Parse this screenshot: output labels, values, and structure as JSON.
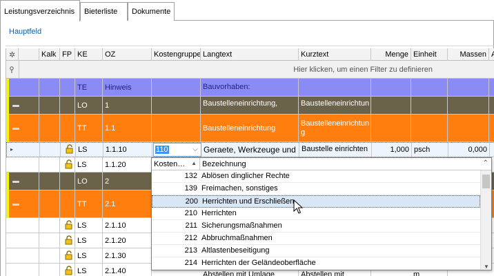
{
  "tabs": [
    "Leistungsverzeichnis",
    "Bieterliste",
    "Dokumente"
  ],
  "hauptfeld": "Hauptfeld",
  "columns": {
    "star": "✲",
    "kalk": "Kalk",
    "fp": "FP",
    "ke": "KE",
    "oz": "OZ",
    "kostengruppe": "Kostengruppe",
    "langtext": "Langtext",
    "kurztext": "Kurztext",
    "menge": "Menge",
    "einheit": "Einheit",
    "massen": "Massen",
    "extra": "A"
  },
  "filter_hint": "Hier klicken, um einen Filter zu definieren",
  "rows": [
    {
      "ke": "TE",
      "oz": "Hinweis",
      "lang": "Bauvorhaben:",
      "kurz": ""
    },
    {
      "ke": "LO",
      "oz": "1",
      "lang": "Baustelleneinrichtung,",
      "kurz": "Baustelleneinrichtun"
    },
    {
      "ke": "TT",
      "oz": "1.1",
      "lang": "Baustelleneinrichtung",
      "kurz": "Baustelleneinrichtun",
      "kurz2": "g"
    },
    {
      "ke": "LS",
      "oz": "1.1.10",
      "kg": "110",
      "lang": "Geraete, Werkzeuge und",
      "kurz": "Baustelle einrichten",
      "menge": "1,000",
      "einheit": "psch",
      "massen": "0,000"
    },
    {
      "ke": "LS",
      "oz": "1.1.20"
    },
    {
      "ke": "LO",
      "oz": "2"
    },
    {
      "ke": "TT",
      "oz": "2.1"
    },
    {
      "ke": "LS",
      "oz": "2.1.10"
    },
    {
      "ke": "LS",
      "oz": "2.1.20"
    },
    {
      "ke": "LS",
      "oz": "2.1.30"
    },
    {
      "ke": "LS",
      "oz": "2.1.40",
      "lang": "Abstellen mit Umlage",
      "kurz": "Abstellen mit",
      "einheit": "m"
    }
  ],
  "popup": {
    "col_code": "Kosten…",
    "col_name": "Bezeichnung",
    "items": [
      {
        "code": "132",
        "name": "Ablösen dinglicher Rechte"
      },
      {
        "code": "139",
        "name": "Freimachen, sonstiges"
      },
      {
        "code": "200",
        "name": "Herrichten und Erschließen"
      },
      {
        "code": "210",
        "name": "Herrichten"
      },
      {
        "code": "211",
        "name": "Sicherungsmaßnahmen"
      },
      {
        "code": "212",
        "name": "Abbruchmaßnahmen"
      },
      {
        "code": "213",
        "name": "Altlastenbeseitigung"
      },
      {
        "code": "214",
        "name": "Herrichten der Geländeoberfläche"
      }
    ]
  },
  "colors": {
    "te": "#8b8bf5",
    "lo": "#6a6249",
    "tt": "#ff7e0d",
    "accent": "#0b5fa8"
  }
}
